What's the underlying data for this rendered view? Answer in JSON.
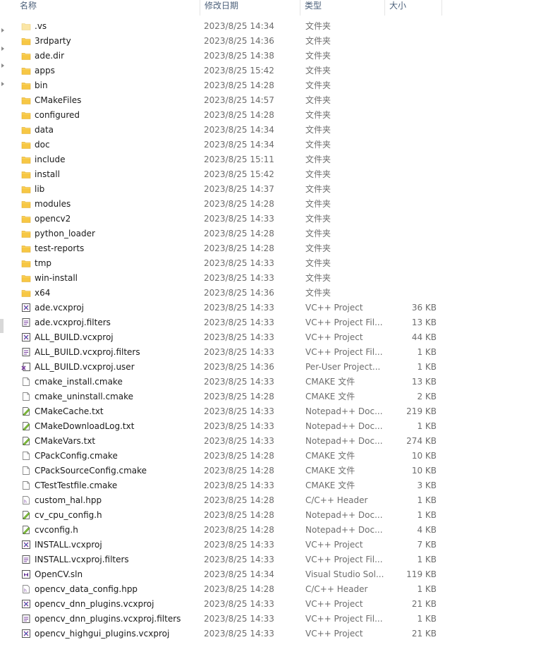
{
  "columns": {
    "name": "名称",
    "date": "修改日期",
    "type": "类型",
    "size": "大小"
  },
  "colors": {
    "folder": "#f7c744",
    "header_text": "#4c607a",
    "meta_text": "#6d6d6d"
  },
  "files": [
    {
      "name": ".vs",
      "date": "2023/8/25 14:34",
      "type": "文件夹",
      "size": "",
      "icon": "folder-icon-light"
    },
    {
      "name": "3rdparty",
      "date": "2023/8/25 14:36",
      "type": "文件夹",
      "size": "",
      "icon": "folder-icon"
    },
    {
      "name": "ade.dir",
      "date": "2023/8/25 14:38",
      "type": "文件夹",
      "size": "",
      "icon": "folder-icon"
    },
    {
      "name": "apps",
      "date": "2023/8/25 15:42",
      "type": "文件夹",
      "size": "",
      "icon": "folder-icon"
    },
    {
      "name": "bin",
      "date": "2023/8/25 14:28",
      "type": "文件夹",
      "size": "",
      "icon": "folder-icon"
    },
    {
      "name": "CMakeFiles",
      "date": "2023/8/25 14:57",
      "type": "文件夹",
      "size": "",
      "icon": "folder-icon"
    },
    {
      "name": "configured",
      "date": "2023/8/25 14:28",
      "type": "文件夹",
      "size": "",
      "icon": "folder-icon"
    },
    {
      "name": "data",
      "date": "2023/8/25 14:34",
      "type": "文件夹",
      "size": "",
      "icon": "folder-icon"
    },
    {
      "name": "doc",
      "date": "2023/8/25 14:34",
      "type": "文件夹",
      "size": "",
      "icon": "folder-icon"
    },
    {
      "name": "include",
      "date": "2023/8/25 15:11",
      "type": "文件夹",
      "size": "",
      "icon": "folder-icon"
    },
    {
      "name": "install",
      "date": "2023/8/25 15:42",
      "type": "文件夹",
      "size": "",
      "icon": "folder-icon"
    },
    {
      "name": "lib",
      "date": "2023/8/25 14:37",
      "type": "文件夹",
      "size": "",
      "icon": "folder-icon"
    },
    {
      "name": "modules",
      "date": "2023/8/25 14:28",
      "type": "文件夹",
      "size": "",
      "icon": "folder-icon"
    },
    {
      "name": "opencv2",
      "date": "2023/8/25 14:33",
      "type": "文件夹",
      "size": "",
      "icon": "folder-icon"
    },
    {
      "name": "python_loader",
      "date": "2023/8/25 14:28",
      "type": "文件夹",
      "size": "",
      "icon": "folder-icon"
    },
    {
      "name": "test-reports",
      "date": "2023/8/25 14:28",
      "type": "文件夹",
      "size": "",
      "icon": "folder-icon"
    },
    {
      "name": "tmp",
      "date": "2023/8/25 14:33",
      "type": "文件夹",
      "size": "",
      "icon": "folder-icon"
    },
    {
      "name": "win-install",
      "date": "2023/8/25 14:33",
      "type": "文件夹",
      "size": "",
      "icon": "folder-icon"
    },
    {
      "name": "x64",
      "date": "2023/8/25 14:36",
      "type": "文件夹",
      "size": "",
      "icon": "folder-icon"
    },
    {
      "name": "ade.vcxproj",
      "date": "2023/8/25 14:33",
      "type": "VC++ Project",
      "size": "36 KB",
      "icon": "vcxproj-icon"
    },
    {
      "name": "ade.vcxproj.filters",
      "date": "2023/8/25 14:33",
      "type": "VC++ Project Fil...",
      "size": "13 KB",
      "icon": "filters-icon"
    },
    {
      "name": "ALL_BUILD.vcxproj",
      "date": "2023/8/25 14:33",
      "type": "VC++ Project",
      "size": "44 KB",
      "icon": "vcxproj-icon"
    },
    {
      "name": "ALL_BUILD.vcxproj.filters",
      "date": "2023/8/25 14:33",
      "type": "VC++ Project Fil...",
      "size": "1 KB",
      "icon": "filters-icon"
    },
    {
      "name": "ALL_BUILD.vcxproj.user",
      "date": "2023/8/25 14:36",
      "type": "Per-User Project...",
      "size": "1 KB",
      "icon": "user-project-icon"
    },
    {
      "name": "cmake_install.cmake",
      "date": "2023/8/25 14:33",
      "type": "CMAKE 文件",
      "size": "13 KB",
      "icon": "file-icon"
    },
    {
      "name": "cmake_uninstall.cmake",
      "date": "2023/8/25 14:28",
      "type": "CMAKE 文件",
      "size": "2 KB",
      "icon": "file-icon"
    },
    {
      "name": "CMakeCache.txt",
      "date": "2023/8/25 14:33",
      "type": "Notepad++ Doc...",
      "size": "219 KB",
      "icon": "notepad-icon"
    },
    {
      "name": "CMakeDownloadLog.txt",
      "date": "2023/8/25 14:33",
      "type": "Notepad++ Doc...",
      "size": "1 KB",
      "icon": "notepad-icon"
    },
    {
      "name": "CMakeVars.txt",
      "date": "2023/8/25 14:33",
      "type": "Notepad++ Doc...",
      "size": "274 KB",
      "icon": "notepad-icon"
    },
    {
      "name": "CPackConfig.cmake",
      "date": "2023/8/25 14:28",
      "type": "CMAKE 文件",
      "size": "10 KB",
      "icon": "file-icon"
    },
    {
      "name": "CPackSourceConfig.cmake",
      "date": "2023/8/25 14:28",
      "type": "CMAKE 文件",
      "size": "10 KB",
      "icon": "file-icon"
    },
    {
      "name": "CTestTestfile.cmake",
      "date": "2023/8/25 14:33",
      "type": "CMAKE 文件",
      "size": "3 KB",
      "icon": "file-icon"
    },
    {
      "name": "custom_hal.hpp",
      "date": "2023/8/25 14:28",
      "type": "C/C++ Header",
      "size": "1 KB",
      "icon": "header-icon"
    },
    {
      "name": "cv_cpu_config.h",
      "date": "2023/8/25 14:28",
      "type": "Notepad++ Doc...",
      "size": "1 KB",
      "icon": "notepad-icon"
    },
    {
      "name": "cvconfig.h",
      "date": "2023/8/25 14:28",
      "type": "Notepad++ Doc...",
      "size": "4 KB",
      "icon": "notepad-icon"
    },
    {
      "name": "INSTALL.vcxproj",
      "date": "2023/8/25 14:33",
      "type": "VC++ Project",
      "size": "7 KB",
      "icon": "vcxproj-icon"
    },
    {
      "name": "INSTALL.vcxproj.filters",
      "date": "2023/8/25 14:33",
      "type": "VC++ Project Fil...",
      "size": "1 KB",
      "icon": "filters-icon"
    },
    {
      "name": "OpenCV.sln",
      "date": "2023/8/25 14:34",
      "type": "Visual Studio Sol...",
      "size": "119 KB",
      "icon": "sln-icon"
    },
    {
      "name": "opencv_data_config.hpp",
      "date": "2023/8/25 14:28",
      "type": "C/C++ Header",
      "size": "1 KB",
      "icon": "header-icon"
    },
    {
      "name": "opencv_dnn_plugins.vcxproj",
      "date": "2023/8/25 14:33",
      "type": "VC++ Project",
      "size": "21 KB",
      "icon": "vcxproj-icon"
    },
    {
      "name": "opencv_dnn_plugins.vcxproj.filters",
      "date": "2023/8/25 14:33",
      "type": "VC++ Project Fil...",
      "size": "1 KB",
      "icon": "filters-icon"
    },
    {
      "name": "opencv_highgui_plugins.vcxproj",
      "date": "2023/8/25 14:33",
      "type": "VC++ Project",
      "size": "21 KB",
      "icon": "vcxproj-icon"
    }
  ]
}
